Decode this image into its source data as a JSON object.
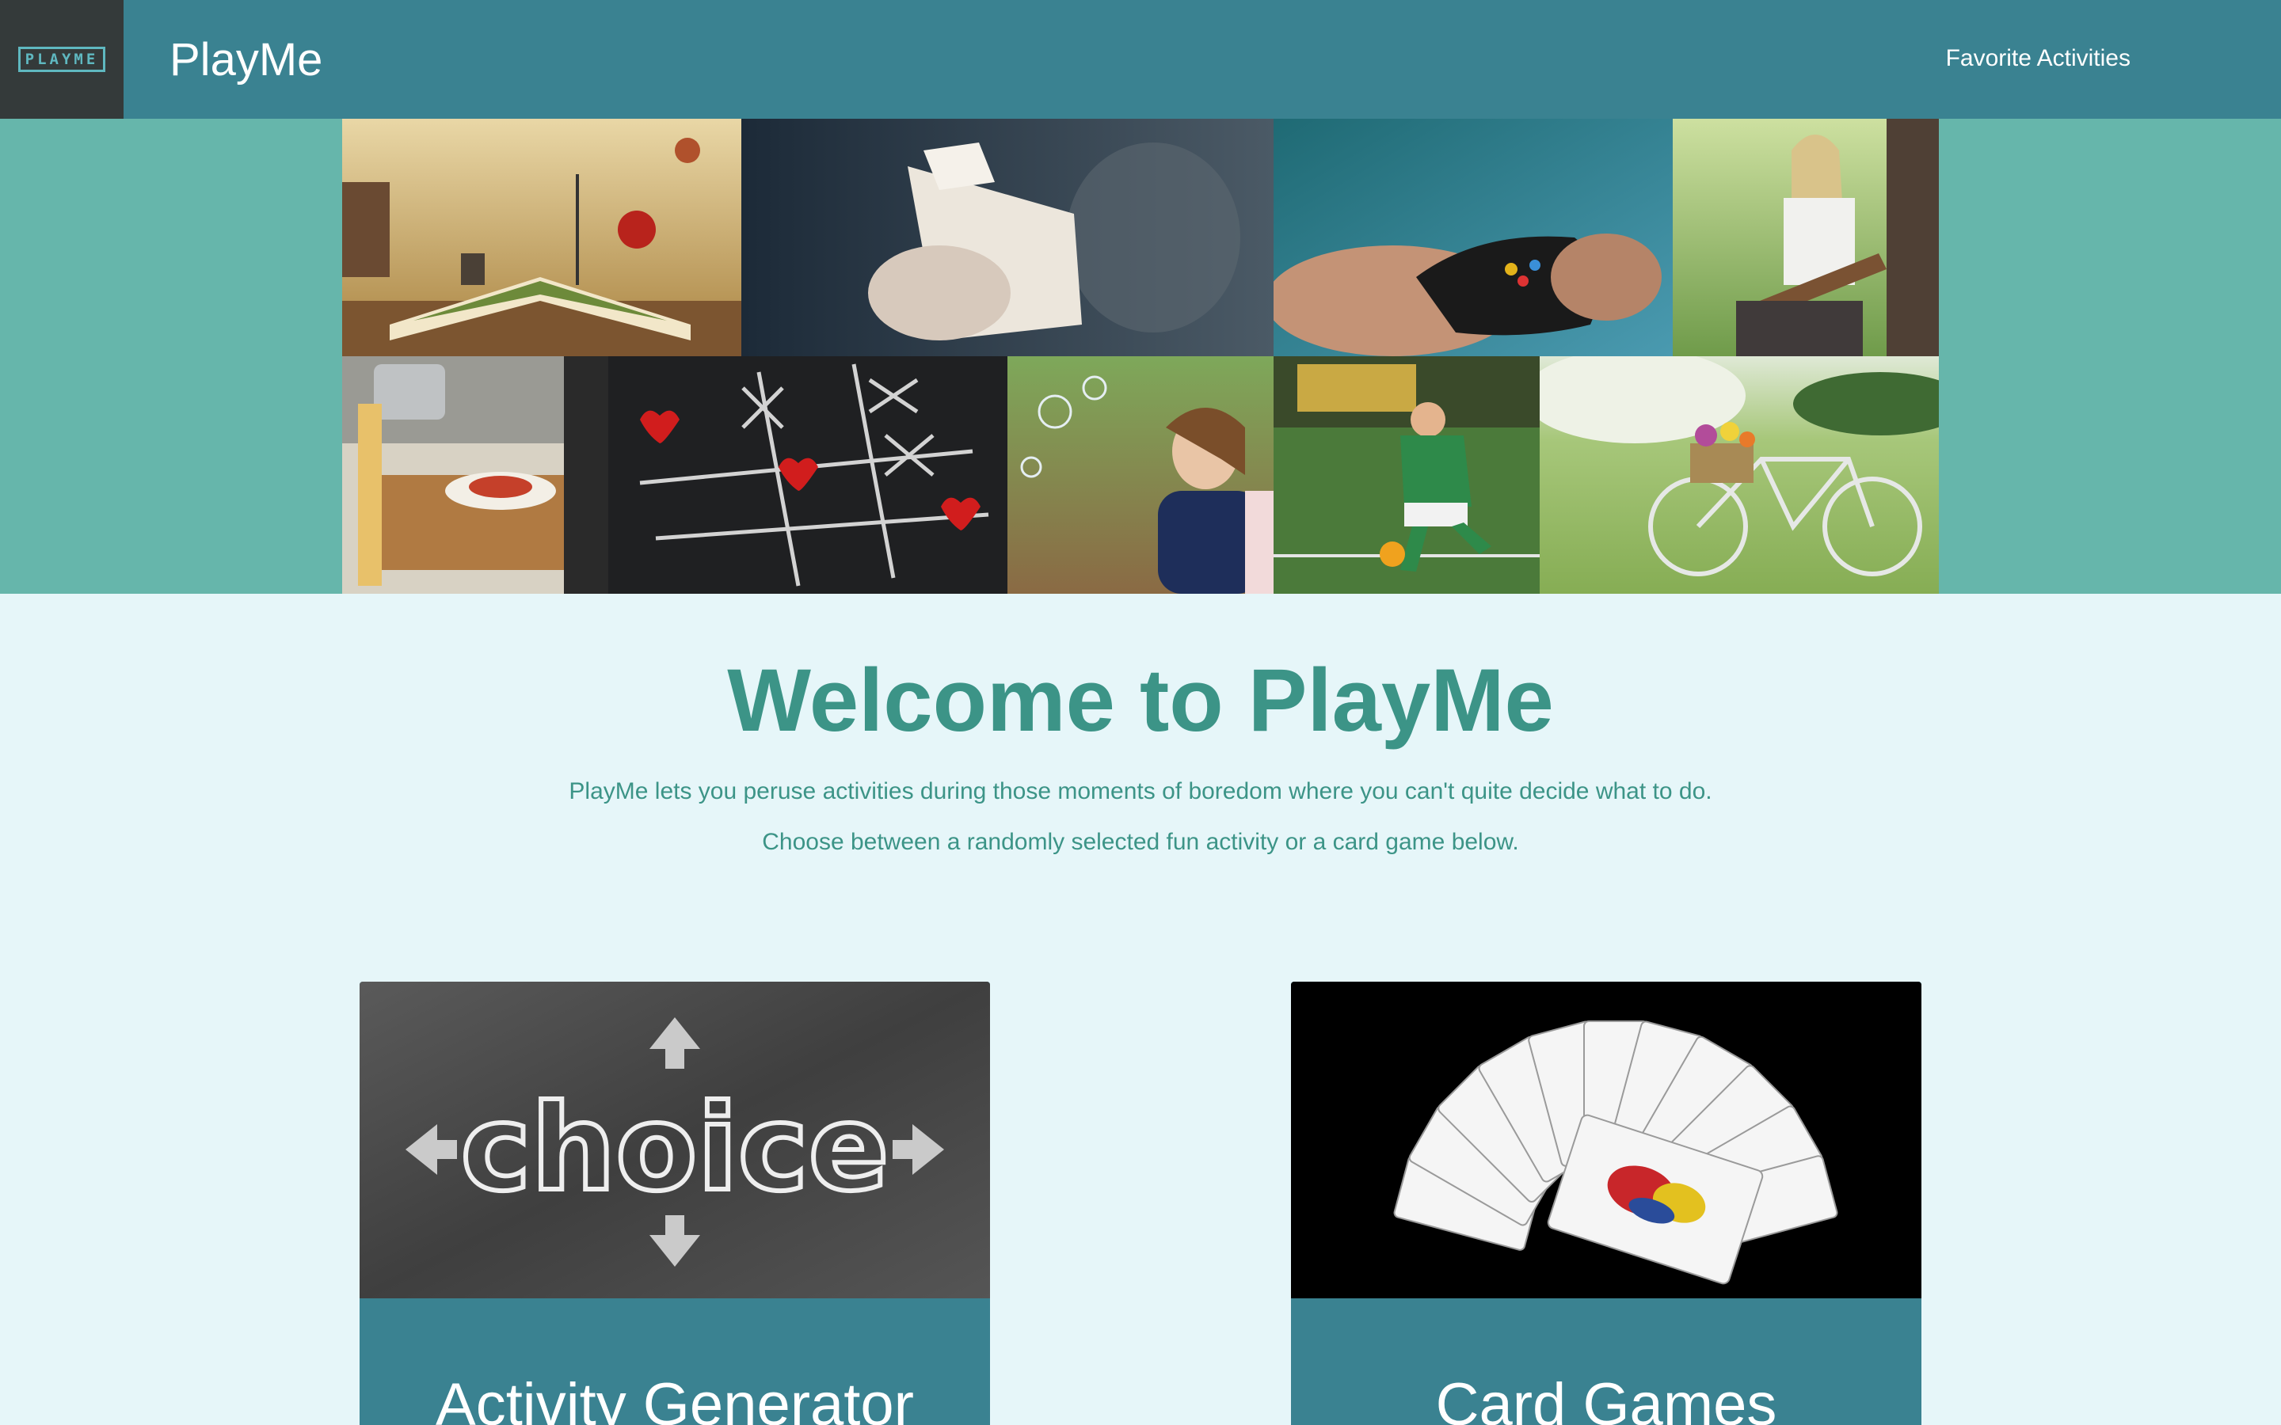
{
  "navbar": {
    "logo_text": "PLAYME",
    "brand": "PlayMe",
    "links": [
      {
        "label": "Favorite Activities"
      }
    ]
  },
  "banner": {
    "photos": [
      {
        "subject": "storybook with dog and umbrella"
      },
      {
        "subject": "hand holding fan of playing cards"
      },
      {
        "subject": "hands holding game controller"
      },
      {
        "subject": "woman playing guitar by tree"
      },
      {
        "subject": "cooking pasta in kitchen"
      },
      {
        "subject": "chalk tic-tac-toe with red hearts"
      },
      {
        "subject": "girl blowing bubbles"
      },
      {
        "subject": "boy kicking soccer ball"
      },
      {
        "subject": "bicycle in flower meadow"
      }
    ]
  },
  "hero": {
    "title": "Welcome to PlayMe",
    "lines": [
      "PlayMe lets you peruse activities during those moments of boredom where you can't quite decide what to do.",
      "Choose between a randomly selected fun activity or a card game below."
    ]
  },
  "cards": [
    {
      "title": "Activity Generator",
      "image_word": "choice"
    },
    {
      "title": "Card Games"
    }
  ],
  "colors": {
    "navbar": "#3a8291",
    "banner": "#66b6ab",
    "page_background": "#e6f6f9",
    "heading_text": "#3c9487"
  }
}
